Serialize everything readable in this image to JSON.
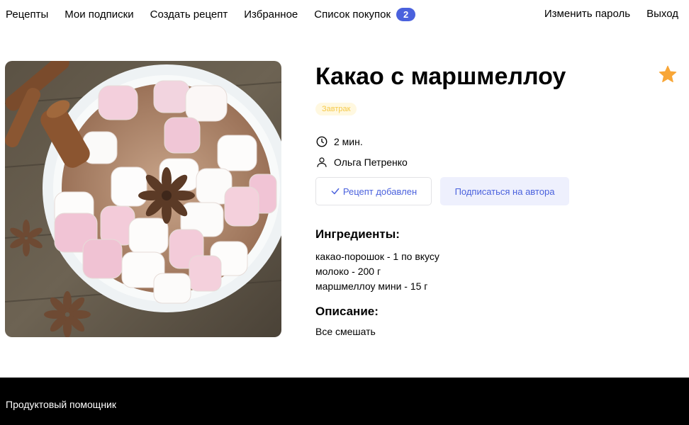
{
  "header": {
    "nav_left": [
      "Рецепты",
      "Мои подписки",
      "Создать рецепт",
      "Избранное"
    ],
    "cart_label": "Список покупок",
    "cart_count": "2",
    "change_password": "Изменить пароль",
    "logout": "Выход",
    "accent_color": "#4a61dd"
  },
  "recipe": {
    "title": "Какао с маршмеллоу",
    "tag": "Завтрак",
    "time": "2 мин.",
    "author": "Ольга Петренко",
    "added_button": "Рецепт добавлен",
    "subscribe_button": "Подписаться на автора",
    "ingredients_title": "Ингредиенты:",
    "ingredients": [
      "какао-порошок - 1 по вкусу",
      "молоко - 200 г",
      "маршмеллоу мини - 15 г"
    ],
    "description_title": "Описание:",
    "description": "Все смешать",
    "favorite_color": "#f8a637"
  },
  "footer": {
    "label": "Продуктовый помощник"
  }
}
